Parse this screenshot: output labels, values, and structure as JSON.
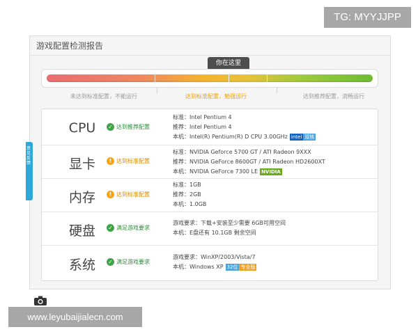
{
  "watermarks": {
    "top": "TG: MYYJJPP",
    "bottom": "www.leyubaijialecn.com"
  },
  "panel": {
    "title": "游戏配置检测报告"
  },
  "gauge": {
    "marker_label": "你在这里",
    "position_fraction": 0.55,
    "levels": [
      "未达到标准配置，不能运行",
      "达到标准配置，勉强运行",
      "达到推荐配置，流畅运行"
    ],
    "active_level": 1
  },
  "side_tab": {
    "text": "意见反馈"
  },
  "rows": [
    {
      "category": "CPU",
      "status": "达到推荐配置",
      "status_type": "ok",
      "lines": [
        {
          "text": "标准：Intel Pentium 4"
        },
        {
          "text": "推荐：Intel Pentium 4"
        },
        {
          "text": "本机：Intel(R) Pentium(R) D CPU 3.00GHz",
          "badges": [
            "intel",
            "双核"
          ]
        }
      ]
    },
    {
      "category": "显卡",
      "status": "达到标准配置",
      "status_type": "warn",
      "lines": [
        {
          "text": "标准：NVIDIA Geforce 5700 GT / ATI Radeon 9XXX"
        },
        {
          "text": "推荐：NVIDIA GeForce 8600GT / ATI Radeon HD2600XT"
        },
        {
          "text": "本机：NVIDIA GeForce 7300 LE",
          "badges": [
            "NVIDIA"
          ]
        }
      ]
    },
    {
      "category": "内存",
      "status": "达到标准配置",
      "status_type": "warn",
      "lines": [
        {
          "text": "标准：1GB"
        },
        {
          "text": "推荐：2GB"
        },
        {
          "text": "本机：1.0GB"
        }
      ]
    },
    {
      "category": "硬盘",
      "status": "满足游戏要求",
      "status_type": "ok",
      "lines": [
        {
          "text": "游戏要求：下载+安装至少需要 6GB可用空间"
        },
        {
          "text": "本机：E盘还有 10.1GB 剩余空间"
        }
      ]
    },
    {
      "category": "系统",
      "status": "满足游戏要求",
      "status_type": "ok",
      "lines": [
        {
          "text": "游戏要求：WinXP/2003/Vista/7"
        },
        {
          "text": "本机：Windows XP",
          "badges": [
            "32位",
            "专业版"
          ]
        }
      ]
    }
  ],
  "colors": {
    "ok": "#3fa447",
    "warn": "#f3a51a",
    "active_level": "#f0a000",
    "intel_badge": "#1565c0",
    "nvidia_badge": "#6aaa1f",
    "side_tab": "#2ea8d8"
  },
  "icons": [
    "check-icon",
    "warning-icon",
    "camera-icon",
    "marker-arrow-icon"
  ]
}
